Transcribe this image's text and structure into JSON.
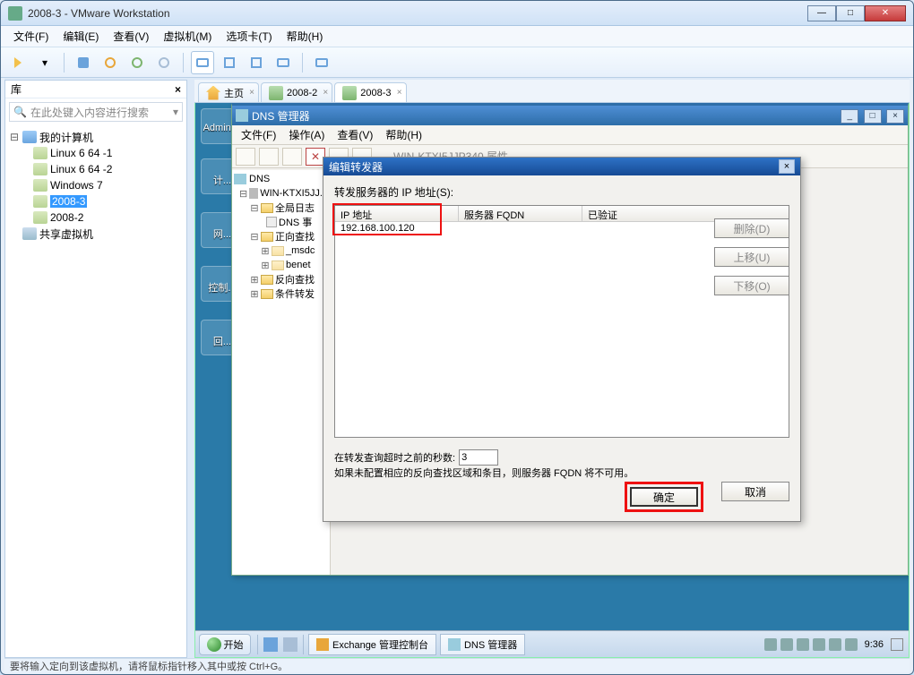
{
  "host_window": {
    "title": "2008-3 - VMware Workstation",
    "winbtns": {
      "min": "—",
      "max": "□",
      "close": "✕"
    }
  },
  "host_menu": [
    "文件(F)",
    "编辑(E)",
    "查看(V)",
    "虚拟机(M)",
    "选项卡(T)",
    "帮助(H)"
  ],
  "lib": {
    "title": "库",
    "close": "×",
    "search_placeholder": "在此处键入内容进行搜索",
    "root": "我的计算机",
    "items": [
      "Linux 6 64 -1",
      "Linux 6 64 -2",
      "Windows 7",
      "2008-3",
      "2008-2"
    ],
    "selected": "2008-3",
    "shared": "共享虚拟机"
  },
  "tabs": [
    {
      "label": "主页",
      "kind": "home"
    },
    {
      "label": "2008-2",
      "kind": "vm"
    },
    {
      "label": "2008-3",
      "kind": "vm",
      "active": true
    }
  ],
  "desktop_labels": [
    "Admini...",
    "计...",
    "网...",
    "控制...",
    "回..."
  ],
  "dns": {
    "title": "DNS 管理器",
    "menu": [
      "文件(F)",
      "操作(A)",
      "查看(V)",
      "帮助(H)"
    ],
    "tree": {
      "root": "DNS",
      "server": "WIN-KTXI5JJ...",
      "global": "全局日志",
      "dns_item": "DNS 事",
      "fwd": "正向查找",
      "msdc": "_msdc",
      "benet": "benet",
      "rev": "反向查找",
      "cond": "条件转发"
    }
  },
  "prop_title_hidden": "WIN-KTXI5JJP340 属性",
  "modal": {
    "title": "编辑转发器",
    "label": "转发服务器的 IP 地址(S):",
    "cols": {
      "ip": "IP 地址",
      "fqdn": "服务器 FQDN",
      "ver": "已验证"
    },
    "row_ip": "192.168.100.120",
    "btn_delete": "删除(D)",
    "btn_up": "上移(U)",
    "btn_down": "下移(O)",
    "timeout_label": "在转发查询超时之前的秒数:",
    "timeout_value": "3",
    "note": "如果未配置相应的反向查找区域和条目，则服务器 FQDN 将不可用。",
    "ok": "确定",
    "cancel": "取消"
  },
  "inner_tb": {
    "start": "开始",
    "tasks": [
      "Exchange 管理控制台",
      "DNS 管理器"
    ],
    "clock": "9:36"
  },
  "statusbar": "要将输入定向到该虚拟机，请将鼠标指针移入其中或按 Ctrl+G。"
}
